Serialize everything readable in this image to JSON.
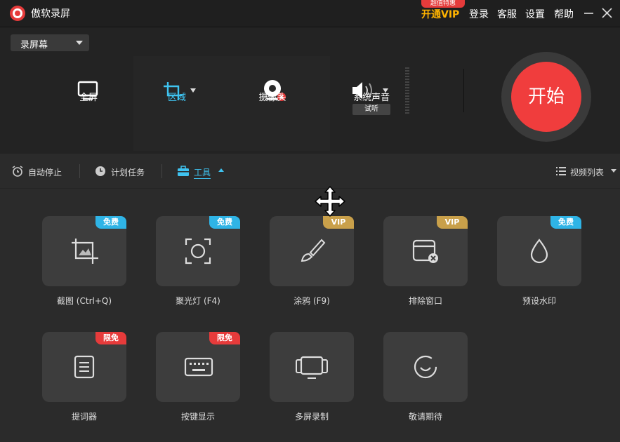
{
  "titlebar": {
    "app_name": "傲软录屏",
    "vip_badge": "超值特惠",
    "vip_link": "开通VIP",
    "login": "登录",
    "support": "客服",
    "settings": "设置",
    "help": "帮助"
  },
  "recorder": {
    "mode": "录屏幕",
    "sources": {
      "fullscreen": "全屏",
      "region": "区域",
      "webcam": "摄像头",
      "system_audio": "系统声音",
      "audio_test": "试听"
    },
    "start": "开始"
  },
  "toolbar": {
    "auto_stop": "自动停止",
    "schedule": "计划任务",
    "tools": "工具",
    "video_list": "视频列表"
  },
  "tools": [
    {
      "label": "截图 (Ctrl+Q)",
      "badge": "免费",
      "badge_type": "free",
      "icon": "crop-screenshot-icon"
    },
    {
      "label": "聚光灯 (F4)",
      "badge": "免费",
      "badge_type": "free",
      "icon": "spotlight-icon"
    },
    {
      "label": "涂鸦 (F9)",
      "badge": "VIP",
      "badge_type": "vip",
      "icon": "brush-icon"
    },
    {
      "label": "排除窗口",
      "badge": "VIP",
      "badge_type": "vip",
      "icon": "exclude-window-icon"
    },
    {
      "label": "预设水印",
      "badge": "免费",
      "badge_type": "free",
      "icon": "watermark-drop-icon"
    },
    {
      "label": "提词器",
      "badge": "限免",
      "badge_type": "limit",
      "icon": "teleprompter-icon"
    },
    {
      "label": "按键显示",
      "badge": "限免",
      "badge_type": "limit",
      "icon": "keyboard-icon"
    },
    {
      "label": "多屏录制",
      "badge": "",
      "badge_type": "",
      "icon": "multi-screen-icon"
    },
    {
      "label": "敬请期待",
      "badge": "",
      "badge_type": "",
      "icon": "smile-icon"
    }
  ],
  "colors": {
    "accent_blue": "#3fc3f0",
    "start_red": "#f03d3d",
    "vip_gold": "#c9a04a",
    "vip_text": "#ffb400",
    "limit_red": "#e63b3b"
  }
}
